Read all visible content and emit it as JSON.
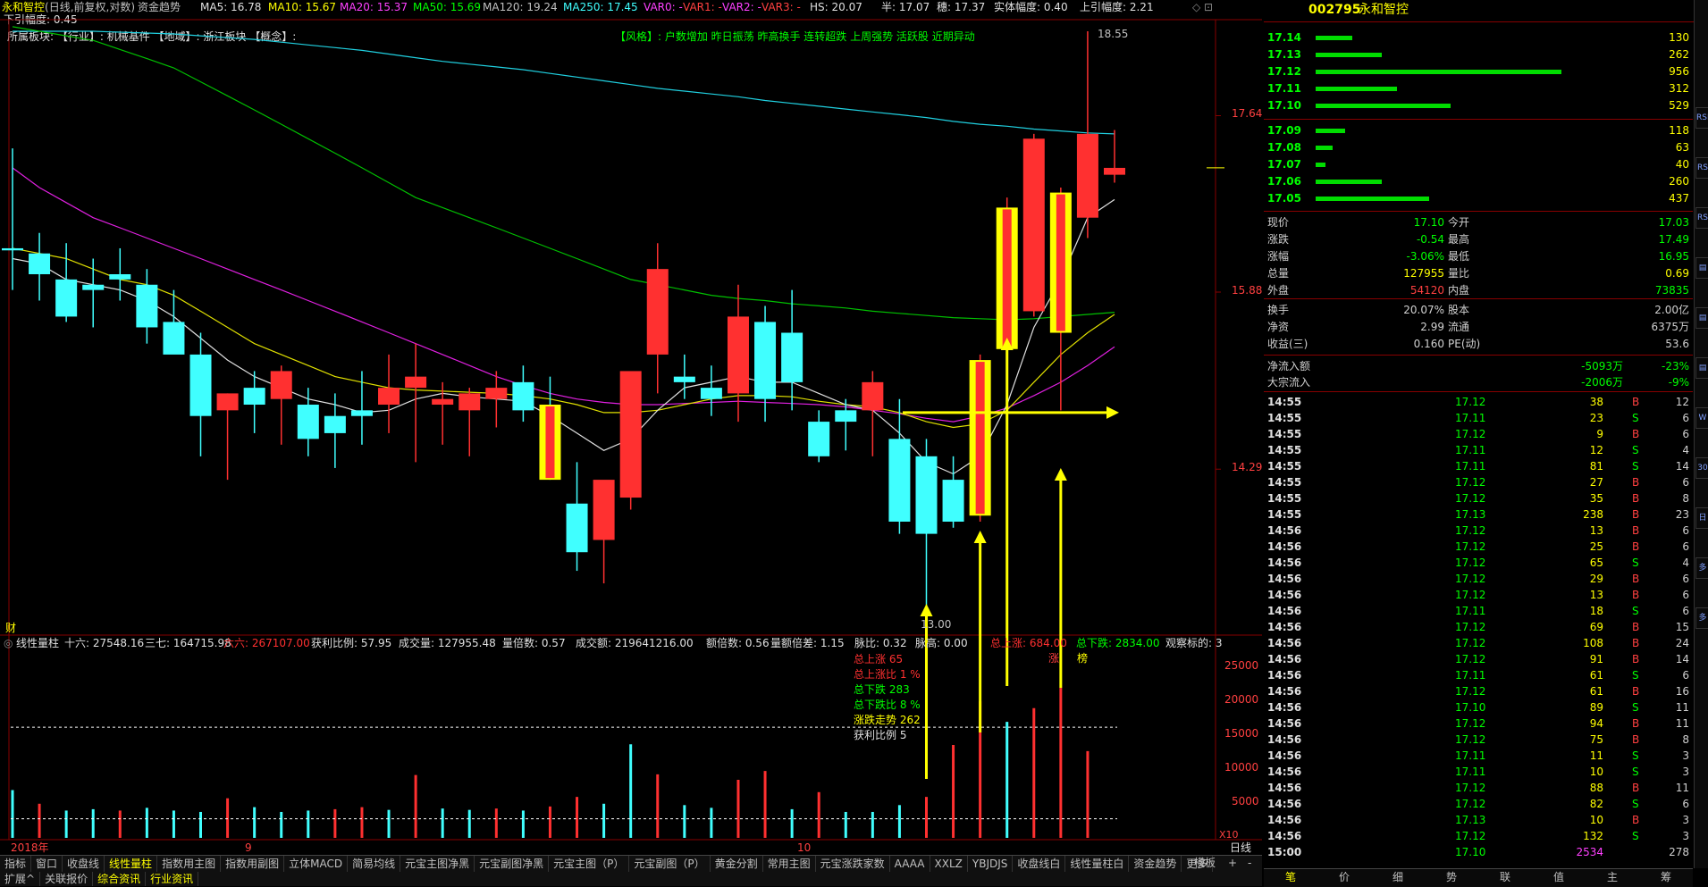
{
  "header": {
    "title": "永和智控",
    "title_suffix": "(日线,前复权,对数)",
    "indicator_name": "资金趋势",
    "ma5": "MA5: 16.78",
    "ma10": "MA10: 15.67",
    "ma20": "MA20: 15.37",
    "ma50": "MA50: 15.69",
    "ma120": "MA120: 19.24",
    "ma250": "MA250: 17.45",
    "var0": "VAR0: -",
    "var1": "VAR1: -",
    "var2": "VAR2: -",
    "var3": "VAR3: -",
    "hs": "HS: 20.07",
    "ban": "半: 17.07",
    "zhong": "穗: 17.37",
    "shiti": "实体幅度: 0.40",
    "shangyin": "上引幅度: 2.21",
    "xiayin": "下引幅度: 0.45"
  },
  "sector": {
    "text": "所属板块: 【行业】: 机械基件 【地域】: 浙江板块 【概念】:",
    "style": "【风格】: 户数增加 昨日振荡 昨高换手 连转超跌 上周强势 活跃股 近期异动"
  },
  "price_labels": {
    "high": "18.55",
    "low": "13.00",
    "p1": "17.64",
    "p2": "15.88",
    "p3": "14.29",
    "cai": "财"
  },
  "chart_data": [
    {
      "type": "candlestick",
      "ylabels": [
        "17.64",
        "15.88",
        "14.29"
      ],
      "candles": [
        {
          "o": 16.3,
          "h": 17.3,
          "l": 15.9,
          "c": 16.28
        },
        {
          "o": 16.25,
          "h": 16.45,
          "l": 15.8,
          "c": 16.05
        },
        {
          "o": 16.0,
          "h": 16.35,
          "l": 15.6,
          "c": 15.65
        },
        {
          "o": 15.95,
          "h": 16.2,
          "l": 15.55,
          "c": 15.9
        },
        {
          "o": 16.05,
          "h": 16.3,
          "l": 15.8,
          "c": 16.0
        },
        {
          "o": 15.95,
          "h": 16.1,
          "l": 15.4,
          "c": 15.55
        },
        {
          "o": 15.6,
          "h": 15.9,
          "l": 15.35,
          "c": 15.3
        },
        {
          "o": 15.3,
          "h": 15.5,
          "l": 14.4,
          "c": 14.75
        },
        {
          "o": 14.8,
          "h": 14.95,
          "l": 14.2,
          "c": 14.95
        },
        {
          "o": 15.0,
          "h": 15.15,
          "l": 14.6,
          "c": 14.85
        },
        {
          "o": 14.9,
          "h": 15.2,
          "l": 14.5,
          "c": 15.15
        },
        {
          "o": 14.85,
          "h": 15.0,
          "l": 14.4,
          "c": 14.55
        },
        {
          "o": 14.75,
          "h": 14.95,
          "l": 14.3,
          "c": 14.6
        },
        {
          "o": 14.8,
          "h": 15.15,
          "l": 14.5,
          "c": 14.75
        },
        {
          "o": 14.85,
          "h": 15.3,
          "l": 14.6,
          "c": 15.0
        },
        {
          "o": 15.0,
          "h": 15.4,
          "l": 14.35,
          "c": 15.1
        },
        {
          "o": 14.85,
          "h": 15.05,
          "l": 14.5,
          "c": 14.9
        },
        {
          "o": 14.8,
          "h": 15.0,
          "l": 14.4,
          "c": 14.95
        },
        {
          "o": 14.9,
          "h": 15.15,
          "l": 14.65,
          "c": 15.0
        },
        {
          "o": 15.05,
          "h": 15.2,
          "l": 14.7,
          "c": 14.8
        },
        {
          "o": 14.85,
          "h": 15.1,
          "l": 14.2,
          "c": 14.2
        },
        {
          "o": 14.0,
          "h": 14.35,
          "l": 13.45,
          "c": 13.6
        },
        {
          "o": 13.7,
          "h": 14.1,
          "l": 13.35,
          "c": 14.2
        },
        {
          "o": 14.05,
          "h": 15.1,
          "l": 13.95,
          "c": 15.15
        },
        {
          "o": 15.3,
          "h": 16.35,
          "l": 14.95,
          "c": 16.1
        },
        {
          "o": 15.1,
          "h": 15.3,
          "l": 14.9,
          "c": 15.05
        },
        {
          "o": 15.0,
          "h": 15.2,
          "l": 14.75,
          "c": 14.9
        },
        {
          "o": 14.95,
          "h": 15.95,
          "l": 14.7,
          "c": 15.65
        },
        {
          "o": 15.6,
          "h": 15.75,
          "l": 14.7,
          "c": 14.9
        },
        {
          "o": 15.5,
          "h": 15.9,
          "l": 14.8,
          "c": 15.05
        },
        {
          "o": 14.7,
          "h": 14.8,
          "l": 14.35,
          "c": 14.4
        },
        {
          "o": 14.8,
          "h": 14.9,
          "l": 14.45,
          "c": 14.7
        },
        {
          "o": 14.8,
          "h": 15.15,
          "l": 14.4,
          "c": 15.05
        },
        {
          "o": 14.55,
          "h": 14.9,
          "l": 13.75,
          "c": 13.85
        },
        {
          "o": 14.4,
          "h": 14.55,
          "l": 13.0,
          "c": 13.75
        },
        {
          "o": 14.2,
          "h": 14.4,
          "l": 13.8,
          "c": 13.85
        },
        {
          "o": 13.9,
          "h": 15.3,
          "l": 13.85,
          "c": 15.25
        },
        {
          "o": 15.35,
          "h": 16.8,
          "l": 15.3,
          "c": 16.7
        },
        {
          "o": 15.7,
          "h": 17.45,
          "l": 15.65,
          "c": 17.4
        },
        {
          "o": 15.5,
          "h": 16.9,
          "l": 14.8,
          "c": 16.85
        },
        {
          "o": 16.6,
          "h": 18.55,
          "l": 16.4,
          "c": 17.45
        },
        {
          "o": 17.03,
          "h": 17.49,
          "l": 16.95,
          "c": 17.1
        }
      ],
      "limit_up_candles": [
        20,
        36,
        37,
        39
      ],
      "ma_white": [
        16.2,
        16.15,
        16.0,
        15.95,
        15.9,
        15.8,
        15.65,
        15.45,
        15.25,
        15.1,
        15.0,
        14.9,
        14.85,
        14.78,
        14.8,
        14.9,
        14.95,
        14.92,
        14.9,
        14.88,
        14.75,
        14.6,
        14.45,
        14.55,
        14.8,
        15.0,
        15.05,
        15.1,
        15.05,
        15.05,
        14.95,
        14.85,
        14.8,
        14.6,
        14.35,
        14.25,
        14.4,
        14.85,
        15.55,
        16.0,
        16.6,
        16.78
      ],
      "ma_yellow": [
        16.3,
        16.25,
        16.2,
        16.1,
        16.0,
        15.95,
        15.85,
        15.7,
        15.55,
        15.4,
        15.3,
        15.2,
        15.1,
        15.05,
        15.0,
        14.98,
        14.97,
        14.96,
        14.95,
        14.93,
        14.9,
        14.85,
        14.78,
        14.78,
        14.8,
        14.85,
        14.9,
        14.93,
        14.93,
        14.92,
        14.88,
        14.85,
        14.83,
        14.78,
        14.7,
        14.65,
        14.68,
        14.8,
        15.05,
        15.3,
        15.5,
        15.67
      ],
      "ma_magenta": [
        17.1,
        16.9,
        16.75,
        16.6,
        16.5,
        16.4,
        16.3,
        16.2,
        16.1,
        16.0,
        15.9,
        15.8,
        15.7,
        15.6,
        15.5,
        15.4,
        15.3,
        15.2,
        15.1,
        15.02,
        14.95,
        14.9,
        14.87,
        14.85,
        14.85,
        14.86,
        14.87,
        14.88,
        14.87,
        14.86,
        14.85,
        14.83,
        14.8,
        14.77,
        14.73,
        14.7,
        14.75,
        14.82,
        14.93,
        15.05,
        15.2,
        15.37
      ],
      "ma_green": [
        18.6,
        18.55,
        18.5,
        18.45,
        18.35,
        18.25,
        18.15,
        18.0,
        17.85,
        17.7,
        17.55,
        17.4,
        17.25,
        17.1,
        16.95,
        16.8,
        16.7,
        16.6,
        16.5,
        16.4,
        16.3,
        16.2,
        16.1,
        16.0,
        15.95,
        15.9,
        15.85,
        15.82,
        15.8,
        15.77,
        15.75,
        15.73,
        15.7,
        15.68,
        15.66,
        15.64,
        15.63,
        15.62,
        15.63,
        15.65,
        15.67,
        15.69
      ],
      "ma_cyan": [
        18.55,
        18.55,
        18.55,
        18.55,
        18.54,
        18.53,
        18.52,
        18.5,
        18.48,
        18.46,
        18.43,
        18.4,
        18.37,
        18.34,
        18.3,
        18.26,
        18.22,
        18.19,
        18.16,
        18.13,
        18.09,
        18.05,
        18.01,
        17.97,
        17.93,
        17.9,
        17.87,
        17.84,
        17.8,
        17.77,
        17.74,
        17.71,
        17.68,
        17.65,
        17.62,
        17.58,
        17.55,
        17.53,
        17.5,
        17.48,
        17.46,
        17.45
      ]
    },
    {
      "type": "bar",
      "title": "线性量柱",
      "values": [
        7000,
        5000,
        4000,
        4200,
        4000,
        4400,
        4000,
        3800,
        5800,
        4500,
        3800,
        4000,
        4200,
        4500,
        4100,
        9200,
        4300,
        4100,
        4300,
        4000,
        4600,
        6000,
        5000,
        13700,
        9300,
        4800,
        4400,
        8500,
        9800,
        4200,
        6700,
        3800,
        3800,
        4800,
        6000,
        13600,
        20000,
        17000,
        19000,
        22000,
        12700
      ],
      "colors": [
        "c",
        "r",
        "c",
        "c",
        "r",
        "c",
        "c",
        "c",
        "r",
        "c",
        "c",
        "c",
        "r",
        "r",
        "c",
        "r",
        "c",
        "c",
        "r",
        "c",
        "r",
        "r",
        "c",
        "c",
        "r",
        "c",
        "c",
        "r",
        "r",
        "c",
        "r",
        "c",
        "c",
        "c",
        "r",
        "r",
        "r",
        "c",
        "r",
        "r",
        "r"
      ],
      "yticks": [
        "25000",
        "20000",
        "15000",
        "10000",
        "5000"
      ],
      "ymax": 28000
    }
  ],
  "indicators": {
    "title": "线性量柱",
    "shiliu": "十六: 27548.16",
    "sanqi": "三七: 164715.98",
    "liuliu": "六六: 267107.00",
    "huoli": "获利比例: 57.95",
    "cjl": "成交量: 127955.48",
    "lbs": "量倍数: 0.57",
    "cje": "成交额: 219641216.00",
    "ebs": "额倍数: 0.56",
    "lec": "量额倍差: 1.15",
    "mb": "脉比: 0.32",
    "mg": "脉高: 0.00",
    "zsz": "总上涨: 684.00",
    "zxd": "总下跌: 2834.00",
    "gcb": "观察标的: 3"
  },
  "annotations": {
    "zsz": "总上涨 65",
    "zszb": "总上涨比 1 %",
    "zxd": "总下跌 283",
    "zxdb": "总下跌比 8 %",
    "zdqs": "涨跌走势 262",
    "hlbl": "获利比例 5",
    "mark_zhang": "涨",
    "mark_bang": "榜"
  },
  "x_axis": {
    "year": "2018年",
    "m9": "9",
    "m10": "10",
    "x10": "X10",
    "rixian": "日线"
  },
  "toolbar": {
    "tabs": [
      "指标",
      "窗口",
      "收盘线",
      "线性量柱",
      "指数用主图",
      "指数用副图",
      "立体MACD",
      "简易均线",
      "元宝主图净黑",
      "元宝副图净黑",
      "元宝主图（P）",
      "元宝副图（P）",
      "黄金分割",
      "常用主图",
      "元宝涨跌家数",
      "AAAA",
      "XXLZ",
      "YBJDJS",
      "收盘线白",
      "线性量柱白",
      "资金趋势",
      "更多"
    ],
    "active": "线性量柱",
    "right": "模板",
    "plus": "+",
    "minus": "-"
  },
  "statusbar": {
    "items": [
      "扩展^",
      "关联报价",
      "综合资讯",
      "行业资讯"
    ]
  },
  "quote": {
    "code": "002795",
    "name": "永和智控",
    "asks": [
      {
        "price": "17.14",
        "vol": "130",
        "w": 0.15
      },
      {
        "price": "17.13",
        "vol": "262",
        "w": 0.27
      },
      {
        "price": "17.12",
        "vol": "956",
        "w": 1.0
      },
      {
        "price": "17.11",
        "vol": "312",
        "w": 0.33
      },
      {
        "price": "17.10",
        "vol": "529",
        "w": 0.55
      }
    ],
    "bids": [
      {
        "price": "17.09",
        "vol": "118",
        "w": 0.12
      },
      {
        "price": "17.08",
        "vol": "63",
        "w": 0.07
      },
      {
        "price": "17.07",
        "vol": "40",
        "w": 0.04
      },
      {
        "price": "17.06",
        "vol": "260",
        "w": 0.27
      },
      {
        "price": "17.05",
        "vol": "437",
        "w": 0.46
      }
    ],
    "stats": [
      {
        "l1": "现价",
        "v1": "17.10",
        "c1": "#00ff00",
        "l2": "今开",
        "v2": "17.03",
        "c2": "#00ff00"
      },
      {
        "l1": "涨跌",
        "v1": "-0.54",
        "c1": "#00ff00",
        "l2": "最高",
        "v2": "17.49",
        "c2": "#00ff00"
      },
      {
        "l1": "涨幅",
        "v1": "-3.06%",
        "c1": "#00ff00",
        "l2": "最低",
        "v2": "16.95",
        "c2": "#00ff00"
      },
      {
        "l1": "总量",
        "v1": "127955",
        "c1": "#ffff00",
        "l2": "量比",
        "v2": "0.69",
        "c2": "#ffff00"
      },
      {
        "l1": "外盘",
        "v1": "54120",
        "c1": "#ff4040",
        "l2": "内盘",
        "v2": "73835",
        "c2": "#00ff00"
      }
    ],
    "stats2": [
      {
        "l1": "换手",
        "v1": "20.07%",
        "c1": "#d0d0d0",
        "l2": "股本",
        "v2": "2.00亿",
        "c2": "#d0d0d0"
      },
      {
        "l1": "净资",
        "v1": "2.99",
        "c1": "#d0d0d0",
        "l2": "流通",
        "v2": "6375万",
        "c2": "#d0d0d0"
      },
      {
        "l1": "收益(三)",
        "v1": "0.160",
        "c1": "#d0d0d0",
        "l2": "PE(动)",
        "v2": "53.6",
        "c2": "#d0d0d0"
      }
    ],
    "flow": [
      {
        "l": "净流入额",
        "v": "-5093万",
        "p": "-23%"
      },
      {
        "l": "大宗流入",
        "v": "-2006万",
        "p": "-9%"
      }
    ],
    "ticks": [
      [
        "14:55",
        "17.12",
        "38",
        "B",
        "12"
      ],
      [
        "14:55",
        "17.11",
        "23",
        "S",
        "6"
      ],
      [
        "14:55",
        "17.12",
        "9",
        "B",
        "6"
      ],
      [
        "14:55",
        "17.11",
        "12",
        "S",
        "4"
      ],
      [
        "14:55",
        "17.11",
        "81",
        "S",
        "14"
      ],
      [
        "14:55",
        "17.12",
        "27",
        "B",
        "6"
      ],
      [
        "14:55",
        "17.12",
        "35",
        "B",
        "8"
      ],
      [
        "14:55",
        "17.13",
        "238",
        "B",
        "23"
      ],
      [
        "14:56",
        "17.12",
        "13",
        "B",
        "6"
      ],
      [
        "14:56",
        "17.12",
        "25",
        "B",
        "6"
      ],
      [
        "14:56",
        "17.12",
        "65",
        "S",
        "4"
      ],
      [
        "14:56",
        "17.12",
        "29",
        "B",
        "6"
      ],
      [
        "14:56",
        "17.12",
        "13",
        "B",
        "6"
      ],
      [
        "14:56",
        "17.11",
        "18",
        "S",
        "6"
      ],
      [
        "14:56",
        "17.12",
        "69",
        "B",
        "15"
      ],
      [
        "14:56",
        "17.12",
        "108",
        "B",
        "24"
      ],
      [
        "14:56",
        "17.12",
        "91",
        "B",
        "14"
      ],
      [
        "14:56",
        "17.11",
        "61",
        "S",
        "6"
      ],
      [
        "14:56",
        "17.12",
        "61",
        "B",
        "16"
      ],
      [
        "14:56",
        "17.10",
        "89",
        "S",
        "11"
      ],
      [
        "14:56",
        "17.12",
        "94",
        "B",
        "11"
      ],
      [
        "14:56",
        "17.12",
        "75",
        "B",
        "8"
      ],
      [
        "14:56",
        "17.11",
        "11",
        "S",
        "3"
      ],
      [
        "14:56",
        "17.11",
        "10",
        "S",
        "3"
      ],
      [
        "14:56",
        "17.12",
        "88",
        "B",
        "11"
      ],
      [
        "14:56",
        "17.12",
        "82",
        "S",
        "6"
      ],
      [
        "14:56",
        "17.13",
        "10",
        "B",
        "3"
      ],
      [
        "14:56",
        "17.12",
        "132",
        "S",
        "3"
      ],
      [
        "15:00",
        "17.10",
        "2534",
        "",
        ""
      ]
    ],
    "tick_end": "278",
    "tabs": [
      "笔",
      "价",
      "细",
      "势",
      "联",
      "值",
      "主",
      "筹"
    ]
  },
  "right_side_icons": [
    "RSI",
    "RS",
    "RS",
    "",
    "",
    "",
    "W",
    "30",
    "日",
    "多",
    "多"
  ],
  "colors": {
    "up": "#ff3030",
    "down": "#40ffff",
    "yellow": "#ffff00",
    "green": "#00ff00"
  }
}
